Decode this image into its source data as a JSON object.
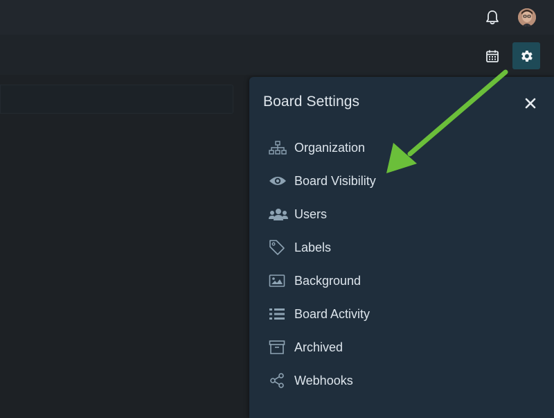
{
  "colors": {
    "background": "#1d2125",
    "panel": "#1f2e3c",
    "accent_button": "#1e4a57",
    "icon": "#8ea3b3",
    "annotation_arrow": "#6bbf3a"
  },
  "topbar": {
    "notification_icon": "bell-icon",
    "avatar": "user-avatar"
  },
  "toolbar": {
    "calendar_icon": "calendar-icon",
    "settings_icon": "gear-icon"
  },
  "panel": {
    "title": "Board Settings",
    "close_icon": "close-icon",
    "items": [
      {
        "label": "Organization",
        "icon": "sitemap-icon"
      },
      {
        "label": "Board Visibility",
        "icon": "eye-icon"
      },
      {
        "label": "Users",
        "icon": "users-icon"
      },
      {
        "label": "Labels",
        "icon": "tag-icon"
      },
      {
        "label": "Background",
        "icon": "image-icon"
      },
      {
        "label": "Board Activity",
        "icon": "list-icon"
      },
      {
        "label": "Archived",
        "icon": "archive-icon"
      },
      {
        "label": "Webhooks",
        "icon": "share-icon"
      }
    ]
  },
  "annotation": {
    "type": "arrow",
    "points_to": "Board Visibility"
  }
}
